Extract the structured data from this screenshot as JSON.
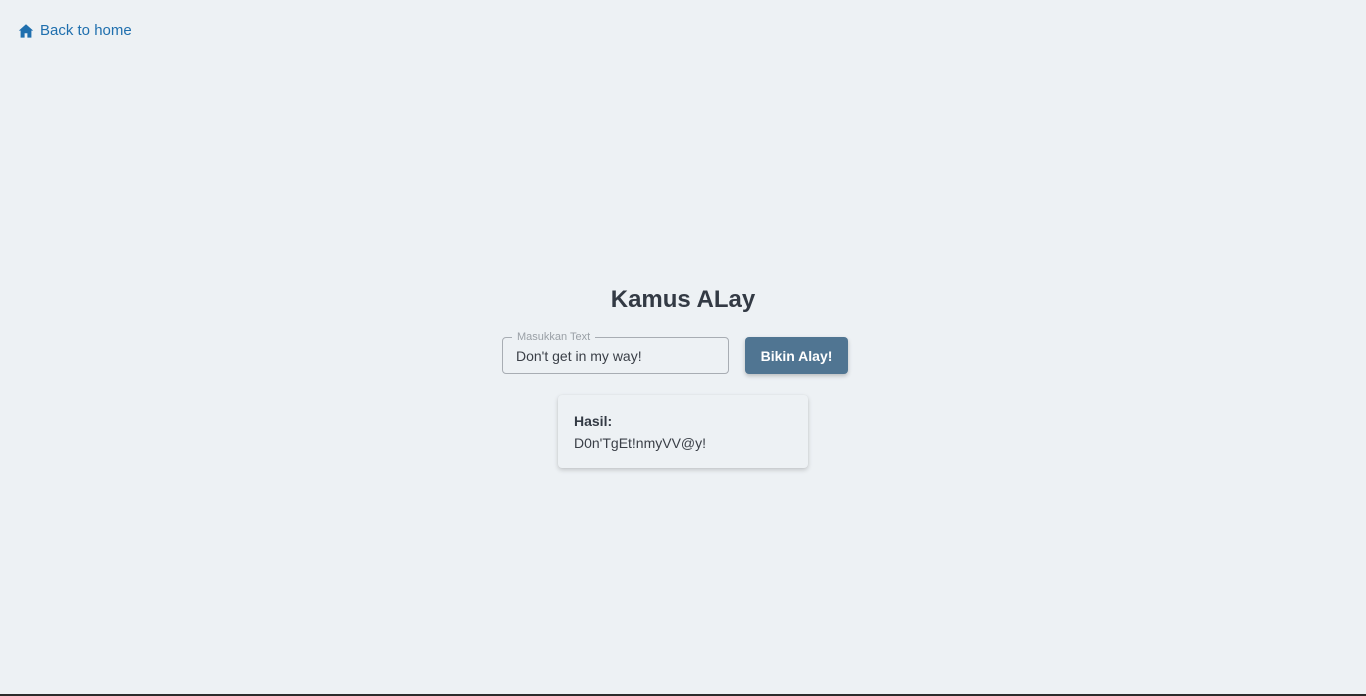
{
  "nav": {
    "back_label": "Back to home",
    "back_icon": "home-icon",
    "link_color": "#1f6fae"
  },
  "main": {
    "title": "Kamus ALay",
    "input": {
      "label": "Masukkan Text",
      "value": "Don't get in my way!"
    },
    "submit_label": "Bikin Alay!",
    "button_color": "#507592",
    "result": {
      "label": "Hasil:",
      "value": "D0n'TgEt!nmyVV@y!"
    }
  },
  "colors": {
    "background": "#edf1f4",
    "text": "#333a44"
  }
}
